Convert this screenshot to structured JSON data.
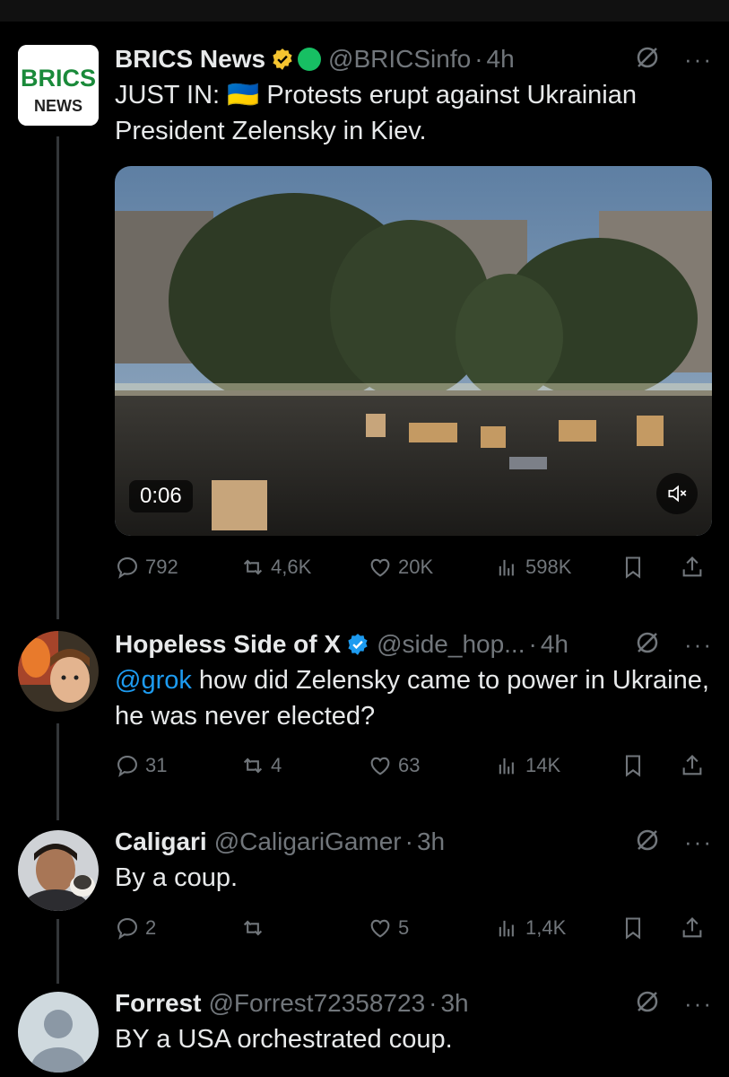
{
  "tweets": [
    {
      "name": "BRICS News",
      "handle": "@BRICSinfo",
      "time": "4h",
      "text_pre": "JUST IN: ",
      "text_flag": "🇺🇦",
      "text": "Protests erupt against Ukrainian President Zelensky in Kiev.",
      "avatar_text": [
        "BRICS",
        "NEWS"
      ],
      "media": {
        "duration": "0:06"
      },
      "stats": {
        "replies": "792",
        "reposts": "4,6K",
        "likes": "20K",
        "views": "598K"
      }
    },
    {
      "name": "Hopeless Side of X",
      "handle": "@side_hop...",
      "time": "4h",
      "mention": "@grok",
      "text": " how did Zelensky came to power in Ukraine, he was never elected?",
      "stats": {
        "replies": "31",
        "reposts": "4",
        "likes": "63",
        "views": "14K"
      }
    },
    {
      "name": "Caligari",
      "handle": "@CaligariGamer",
      "time": "3h",
      "text": "By a coup.",
      "stats": {
        "replies": "2",
        "reposts": "",
        "likes": "5",
        "views": "1,4K"
      }
    },
    {
      "name": "Forrest",
      "handle": "@Forrest72358723",
      "time": "3h",
      "text": "BY a USA orchestrated coup."
    }
  ],
  "colors": {
    "accent": "#1d9bf0",
    "muted": "#71767b",
    "text": "#e7e9ea",
    "bg": "#000000"
  },
  "icons": [
    "reply-icon",
    "repost-icon",
    "like-icon",
    "views-icon",
    "bookmark-icon",
    "share-icon",
    "grok-icon",
    "more-icon",
    "mute-icon"
  ]
}
